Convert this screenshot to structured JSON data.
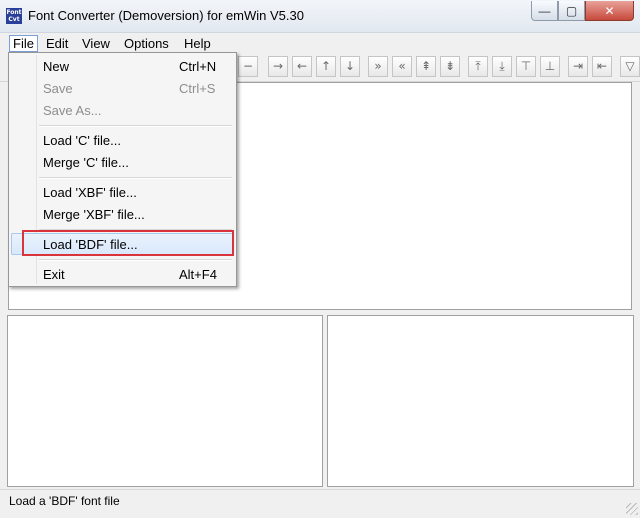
{
  "window": {
    "title": "Font Converter (Demoversion) for emWin V5.30",
    "app_icon_text": "Font Cvt",
    "controls": {
      "minimize": "—",
      "maximize": "▢",
      "close": "✕"
    }
  },
  "menubar": {
    "file": "File",
    "edit": "Edit",
    "view": "View",
    "options": "Options",
    "help": "Help"
  },
  "file_menu": {
    "new": {
      "label": "New",
      "accel": "Ctrl+N"
    },
    "save": {
      "label": "Save",
      "accel": "Ctrl+S"
    },
    "save_as": {
      "label": "Save As..."
    },
    "load_c": {
      "label": "Load 'C' file..."
    },
    "merge_c": {
      "label": "Merge 'C' file..."
    },
    "load_xbf": {
      "label": "Load 'XBF' file..."
    },
    "merge_xbf": {
      "label": "Merge 'XBF' file..."
    },
    "load_bdf": {
      "label": "Load 'BDF' file..."
    },
    "exit": {
      "label": "Exit",
      "accel": "Alt+F4"
    }
  },
  "toolbar": {
    "glyphs": [
      "−",
      "→",
      "←",
      "↑",
      "↓",
      "»",
      "«",
      "⇞",
      "⇟",
      "⤒",
      "⤓",
      "⊤",
      "⊥",
      "⇥",
      "⇤",
      "▽"
    ],
    "icon_names": [
      "minus-icon",
      "arrow-right-icon",
      "arrow-left-icon",
      "arrow-up-icon",
      "arrow-down-icon",
      "double-right-icon",
      "double-left-icon",
      "double-up-icon",
      "double-down-icon",
      "arrow-up-bar-icon",
      "arrow-down-bar-icon",
      "bar-down-icon",
      "bar-up-icon",
      "arrow-right-bar-icon",
      "arrow-left-bar-icon",
      "filter-icon"
    ]
  },
  "statusbar": {
    "text": "Load a 'BDF' font file"
  },
  "colors": {
    "highlight_box": "#d9343c",
    "menu_hover": "#d9e8fb",
    "close_button": "#c74a3c"
  }
}
